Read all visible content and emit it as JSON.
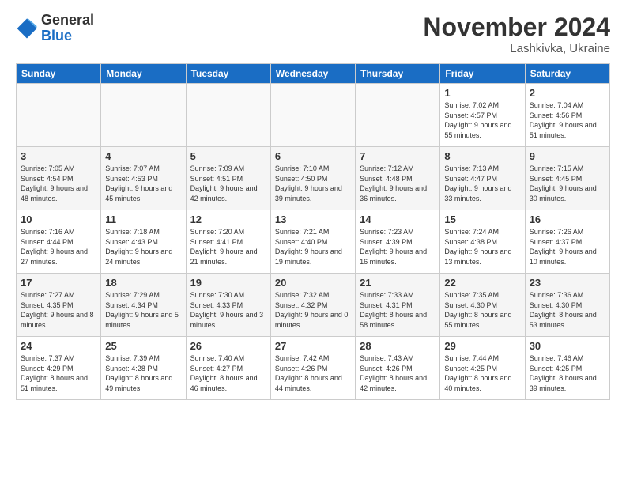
{
  "logo": {
    "general": "General",
    "blue": "Blue"
  },
  "title": {
    "month": "November 2024",
    "location": "Lashkivka, Ukraine"
  },
  "days_of_week": [
    "Sunday",
    "Monday",
    "Tuesday",
    "Wednesday",
    "Thursday",
    "Friday",
    "Saturday"
  ],
  "weeks": [
    [
      {
        "day": "",
        "info": ""
      },
      {
        "day": "",
        "info": ""
      },
      {
        "day": "",
        "info": ""
      },
      {
        "day": "",
        "info": ""
      },
      {
        "day": "",
        "info": ""
      },
      {
        "day": "1",
        "info": "Sunrise: 7:02 AM\nSunset: 4:57 PM\nDaylight: 9 hours and 55 minutes."
      },
      {
        "day": "2",
        "info": "Sunrise: 7:04 AM\nSunset: 4:56 PM\nDaylight: 9 hours and 51 minutes."
      }
    ],
    [
      {
        "day": "3",
        "info": "Sunrise: 7:05 AM\nSunset: 4:54 PM\nDaylight: 9 hours and 48 minutes."
      },
      {
        "day": "4",
        "info": "Sunrise: 7:07 AM\nSunset: 4:53 PM\nDaylight: 9 hours and 45 minutes."
      },
      {
        "day": "5",
        "info": "Sunrise: 7:09 AM\nSunset: 4:51 PM\nDaylight: 9 hours and 42 minutes."
      },
      {
        "day": "6",
        "info": "Sunrise: 7:10 AM\nSunset: 4:50 PM\nDaylight: 9 hours and 39 minutes."
      },
      {
        "day": "7",
        "info": "Sunrise: 7:12 AM\nSunset: 4:48 PM\nDaylight: 9 hours and 36 minutes."
      },
      {
        "day": "8",
        "info": "Sunrise: 7:13 AM\nSunset: 4:47 PM\nDaylight: 9 hours and 33 minutes."
      },
      {
        "day": "9",
        "info": "Sunrise: 7:15 AM\nSunset: 4:45 PM\nDaylight: 9 hours and 30 minutes."
      }
    ],
    [
      {
        "day": "10",
        "info": "Sunrise: 7:16 AM\nSunset: 4:44 PM\nDaylight: 9 hours and 27 minutes."
      },
      {
        "day": "11",
        "info": "Sunrise: 7:18 AM\nSunset: 4:43 PM\nDaylight: 9 hours and 24 minutes."
      },
      {
        "day": "12",
        "info": "Sunrise: 7:20 AM\nSunset: 4:41 PM\nDaylight: 9 hours and 21 minutes."
      },
      {
        "day": "13",
        "info": "Sunrise: 7:21 AM\nSunset: 4:40 PM\nDaylight: 9 hours and 19 minutes."
      },
      {
        "day": "14",
        "info": "Sunrise: 7:23 AM\nSunset: 4:39 PM\nDaylight: 9 hours and 16 minutes."
      },
      {
        "day": "15",
        "info": "Sunrise: 7:24 AM\nSunset: 4:38 PM\nDaylight: 9 hours and 13 minutes."
      },
      {
        "day": "16",
        "info": "Sunrise: 7:26 AM\nSunset: 4:37 PM\nDaylight: 9 hours and 10 minutes."
      }
    ],
    [
      {
        "day": "17",
        "info": "Sunrise: 7:27 AM\nSunset: 4:35 PM\nDaylight: 9 hours and 8 minutes."
      },
      {
        "day": "18",
        "info": "Sunrise: 7:29 AM\nSunset: 4:34 PM\nDaylight: 9 hours and 5 minutes."
      },
      {
        "day": "19",
        "info": "Sunrise: 7:30 AM\nSunset: 4:33 PM\nDaylight: 9 hours and 3 minutes."
      },
      {
        "day": "20",
        "info": "Sunrise: 7:32 AM\nSunset: 4:32 PM\nDaylight: 9 hours and 0 minutes."
      },
      {
        "day": "21",
        "info": "Sunrise: 7:33 AM\nSunset: 4:31 PM\nDaylight: 8 hours and 58 minutes."
      },
      {
        "day": "22",
        "info": "Sunrise: 7:35 AM\nSunset: 4:30 PM\nDaylight: 8 hours and 55 minutes."
      },
      {
        "day": "23",
        "info": "Sunrise: 7:36 AM\nSunset: 4:30 PM\nDaylight: 8 hours and 53 minutes."
      }
    ],
    [
      {
        "day": "24",
        "info": "Sunrise: 7:37 AM\nSunset: 4:29 PM\nDaylight: 8 hours and 51 minutes."
      },
      {
        "day": "25",
        "info": "Sunrise: 7:39 AM\nSunset: 4:28 PM\nDaylight: 8 hours and 49 minutes."
      },
      {
        "day": "26",
        "info": "Sunrise: 7:40 AM\nSunset: 4:27 PM\nDaylight: 8 hours and 46 minutes."
      },
      {
        "day": "27",
        "info": "Sunrise: 7:42 AM\nSunset: 4:26 PM\nDaylight: 8 hours and 44 minutes."
      },
      {
        "day": "28",
        "info": "Sunrise: 7:43 AM\nSunset: 4:26 PM\nDaylight: 8 hours and 42 minutes."
      },
      {
        "day": "29",
        "info": "Sunrise: 7:44 AM\nSunset: 4:25 PM\nDaylight: 8 hours and 40 minutes."
      },
      {
        "day": "30",
        "info": "Sunrise: 7:46 AM\nSunset: 4:25 PM\nDaylight: 8 hours and 39 minutes."
      }
    ]
  ]
}
